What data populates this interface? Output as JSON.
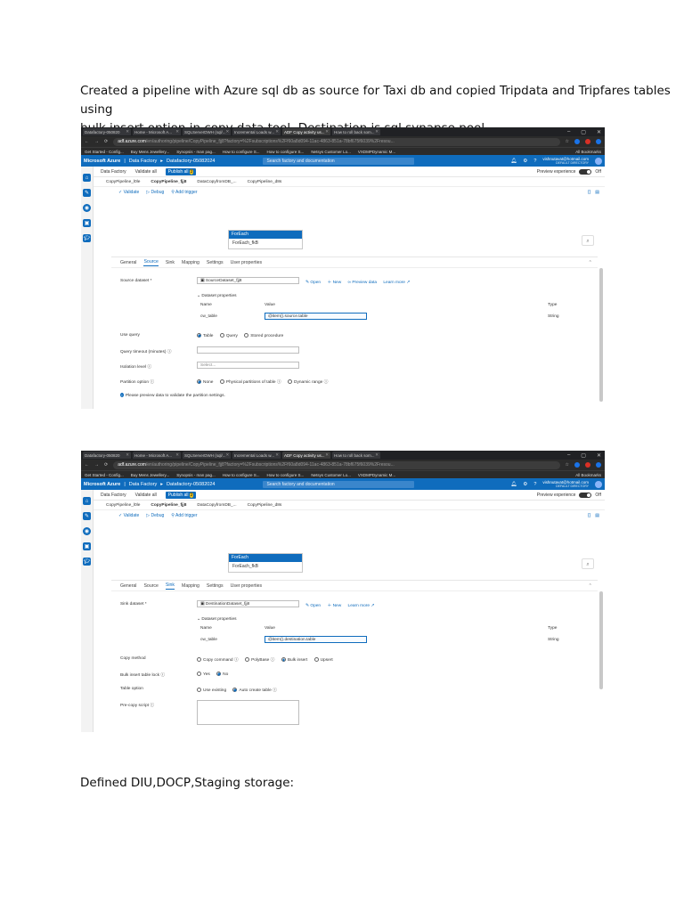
{
  "text": {
    "intro_line1": "Created a pipeline with Azure sql db as source for Taxi db and copied Tripdata and Tripfares tables using",
    "intro_line2": "bulk insert option in copy data tool. Destination is sql synapse pool",
    "footer": "Defined DIU,DOCP,Staging storage:"
  },
  "browser": {
    "tabs": [
      "Datafactory-050820",
      "Home - Microsoft A...",
      "SQLServerDWH (sql/...",
      "Incremental Loads w...",
      "ADF Copy activity us...",
      "How to roll back som..."
    ],
    "url_host": "adf.azure.com",
    "url_path": "/en/authoring/pipeline/CopyPipeline_fjj8?factory=%2Fsubscriptions%2Ff60a8d094-11ac-4863-851a-78bf675f6039%2Fresou...",
    "bookmarks": [
      "Get Started - Config...",
      "Buy Mens Jewellery...",
      "Synopsis - man pag...",
      "How to configure S...",
      "How to configure S...",
      "Netsys Customer Lo...",
      "VXDMPDynamic M..."
    ],
    "all_bookmarks": "All Bookmarks"
  },
  "azure": {
    "brand": "Microsoft Azure",
    "crumb1": "Data Factory",
    "crumb2": "Datafactory-05082024",
    "search_placeholder": "Search factory and documentation",
    "user_email": "vishnutavat@hotmail.com",
    "user_dir": "DEFAULT DIRECTORY",
    "toolbar": {
      "factory": "Data Factory",
      "validate_all": "Validate all",
      "publish_all": "Publish all",
      "publish_count": "3",
      "preview": "Preview experience",
      "off": "Off"
    },
    "pipeline_tabs": [
      "CopyPipeline_l0le",
      "CopyPipeline_fjj8",
      "DataCopyfromDB_...",
      "CopyPipeline_d8s"
    ],
    "canvas": {
      "validate": "Validate",
      "debug": "Debug",
      "add_trigger": "Add trigger"
    },
    "foreach_header": "ForEach",
    "foreach_body": "ForEach_fkB"
  },
  "shot1": {
    "tabs": [
      "General",
      "Source",
      "Sink",
      "Mapping",
      "Settings",
      "User properties"
    ],
    "active_tab": "Source",
    "source_dataset_label": "Source dataset *",
    "source_dataset_value": "SourceDataset_fjj8",
    "open": "Open",
    "new": "New",
    "preview_data": "Preview data",
    "learn_more": "Learn more",
    "dataset_props": "Dataset properties",
    "col_name": "Name",
    "col_value": "Value",
    "col_type": "Type",
    "prop_name": "cw_table",
    "prop_value": "@item().source.table",
    "prop_type": "String",
    "use_query_label": "Use query",
    "use_query_opts": [
      "Table",
      "Query",
      "Stored procedure"
    ],
    "timeout_label": "Query timeout (minutes)",
    "isolation_label": "Isolation level",
    "isolation_placeholder": "Select...",
    "partition_label": "Partition option",
    "partition_opts": [
      "None",
      "Physical partitions of table",
      "Dynamic range"
    ],
    "info_msg": "Please preview data to validate the partition settings."
  },
  "shot2": {
    "tabs": [
      "General",
      "Source",
      "Sink",
      "Mapping",
      "Settings",
      "User properties"
    ],
    "active_tab": "Sink",
    "sink_dataset_label": "Sink dataset *",
    "sink_dataset_value": "DestinationDataset_fjj8",
    "open": "Open",
    "new": "New",
    "learn_more": "Learn more",
    "dataset_props": "Dataset properties",
    "col_name": "Name",
    "col_value": "Value",
    "col_type": "Type",
    "prop_name": "cw_table",
    "prop_value": "@item().destination.table",
    "prop_type": "String",
    "copy_method_label": "Copy method",
    "copy_method_opts": [
      "Copy command",
      "PolyBase",
      "Bulk insert",
      "Upsert"
    ],
    "bulk_lock_label": "Bulk insert table lock",
    "bulk_lock_opts": [
      "Yes",
      "No"
    ],
    "table_option_label": "Table option",
    "table_option_opts": [
      "Use existing",
      "Auto create table"
    ],
    "precopy_label": "Pre-copy script"
  }
}
